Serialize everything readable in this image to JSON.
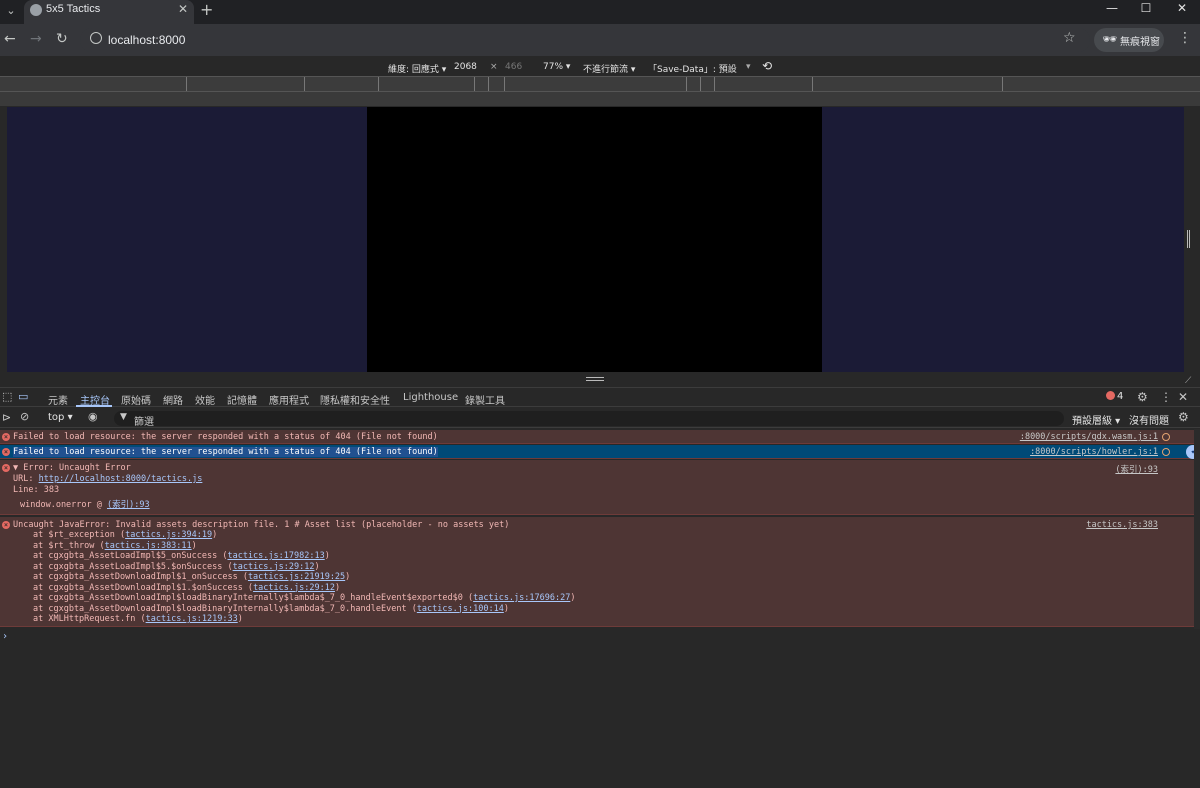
{
  "browser": {
    "tab_title": "5x5 Tactics",
    "url": "localhost:8000",
    "incognito_label": "無痕視窗"
  },
  "device_toolbar": {
    "dimensions_label": "維度: 回應式 ▾",
    "width": "2068",
    "times": "×",
    "height": "466",
    "zoom": "77% ▾",
    "throttle": "不進行節流 ▾",
    "save_data": "「Save-Data」: 預設",
    "dropdown": "▾"
  },
  "devtools": {
    "tabs": [
      "元素",
      "主控台",
      "原始碼",
      "網路",
      "效能",
      "記憶體",
      "應用程式",
      "隱私權和安全性",
      "Lighthouse",
      "錄製工具"
    ],
    "error_count": "4",
    "context": "top ▾",
    "filter_placeholder": "篩選",
    "level": "預設層級 ▾",
    "issues": "沒有問題"
  },
  "console": {
    "msg1": {
      "text": "Failed to load resource: the server responded with a status of 404 (File not found)",
      "source": ":8000/scripts/gdx.wasm.js:1"
    },
    "msg2": {
      "text": "Failed to load resource: the server responded with a status of 404 (File not found)",
      "source": ":8000/scripts/howler.js:1"
    },
    "msg3": {
      "title": "▼ Error: Uncaught Error",
      "url_label": "URL: ",
      "url": "http://localhost:8000/tactics.js",
      "line": "Line: 383",
      "handler": "window.onerror @ ",
      "handler_link": "(索引):93",
      "source": "(索引):93"
    },
    "msg4": {
      "title": "Uncaught JavaError: Invalid assets description file. 1 # Asset list (placeholder - no assets yet)",
      "source": "tactics.js:383",
      "trace": [
        {
          "fn": "at $rt_exception (",
          "loc": "tactics.js:394:19"
        },
        {
          "fn": "at $rt_throw (",
          "loc": "tactics.js:383:11"
        },
        {
          "fn": "at cgxgbta_AssetLoadImpl$5_onSuccess (",
          "loc": "tactics.js:17982:13"
        },
        {
          "fn": "at cgxgbta_AssetLoadImpl$5.$onSuccess (",
          "loc": "tactics.js:29:12"
        },
        {
          "fn": "at cgxgbta_AssetDownloadImpl$1_onSuccess (",
          "loc": "tactics.js:21919:25"
        },
        {
          "fn": "at cgxgbta_AssetDownloadImpl$1.$onSuccess (",
          "loc": "tactics.js:29:12"
        },
        {
          "fn": "at cgxgbta_AssetDownloadImpl$loadBinaryInternally$lambda$_7_0_handleEvent$exported$0 (",
          "loc": "tactics.js:17696:27"
        },
        {
          "fn": "at cgxgbta_AssetDownloadImpl$loadBinaryInternally$lambda$_7_0.handleEvent (",
          "loc": "tactics.js:100:14"
        },
        {
          "fn": "at XMLHttpRequest.fn (",
          "loc": "tactics.js:1219:33"
        }
      ]
    },
    "prompt": "›"
  }
}
